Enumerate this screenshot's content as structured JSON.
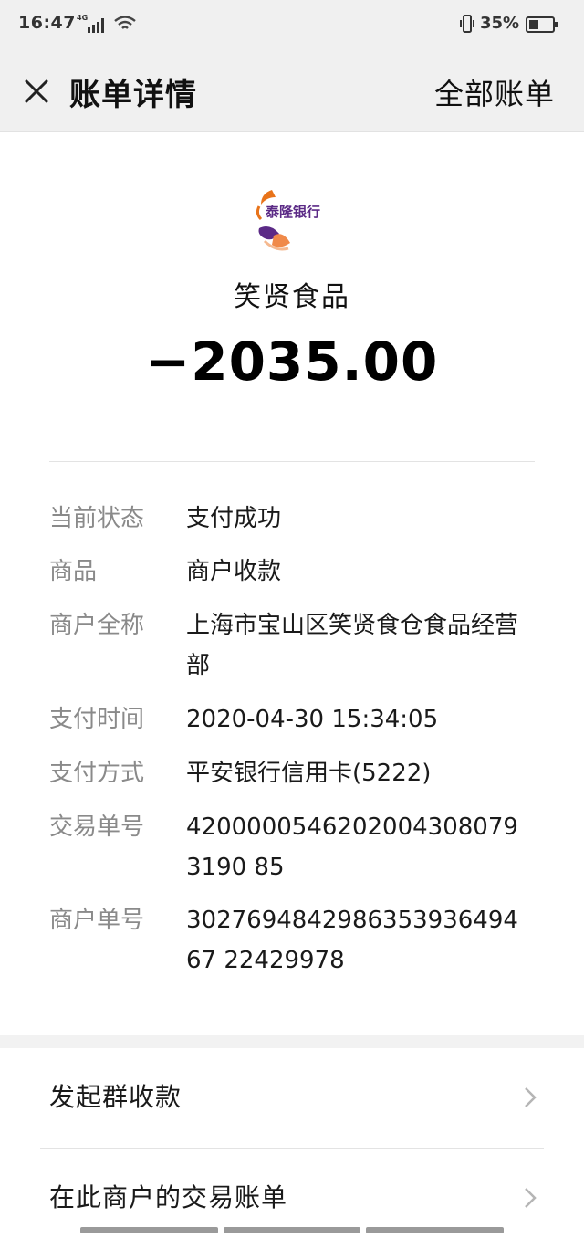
{
  "status_bar": {
    "time": "16:47",
    "network": "4G",
    "battery": "35%"
  },
  "nav": {
    "title": "账单详情",
    "all_bills": "全部账单"
  },
  "header": {
    "logo_text": "泰隆银行",
    "merchant": "笑贤食品",
    "amount": "−2035.00"
  },
  "details": [
    {
      "label": "当前状态",
      "value": "支付成功"
    },
    {
      "label": "商品",
      "value": "商户收款"
    },
    {
      "label": "商户全称",
      "value": "上海市宝山区笑贤食仓食品经营部"
    },
    {
      "label": "支付时间",
      "value": "2020-04-30 15:34:05"
    },
    {
      "label": "支付方式",
      "value": "平安银行信用卡(5222)"
    },
    {
      "label": "交易单号",
      "value": "42000005462020043080793190 85"
    },
    {
      "label": "商户单号",
      "value": "302769484298635393649467 22429978"
    }
  ],
  "actions": [
    {
      "label": "发起群收款"
    },
    {
      "label": "在此商户的交易账单"
    }
  ],
  "colors": {
    "bar_bg": "#f0f0f0",
    "label_gray": "#8a8a8a",
    "logo_orange": "#e8731a",
    "logo_purple": "#5b2a86"
  }
}
